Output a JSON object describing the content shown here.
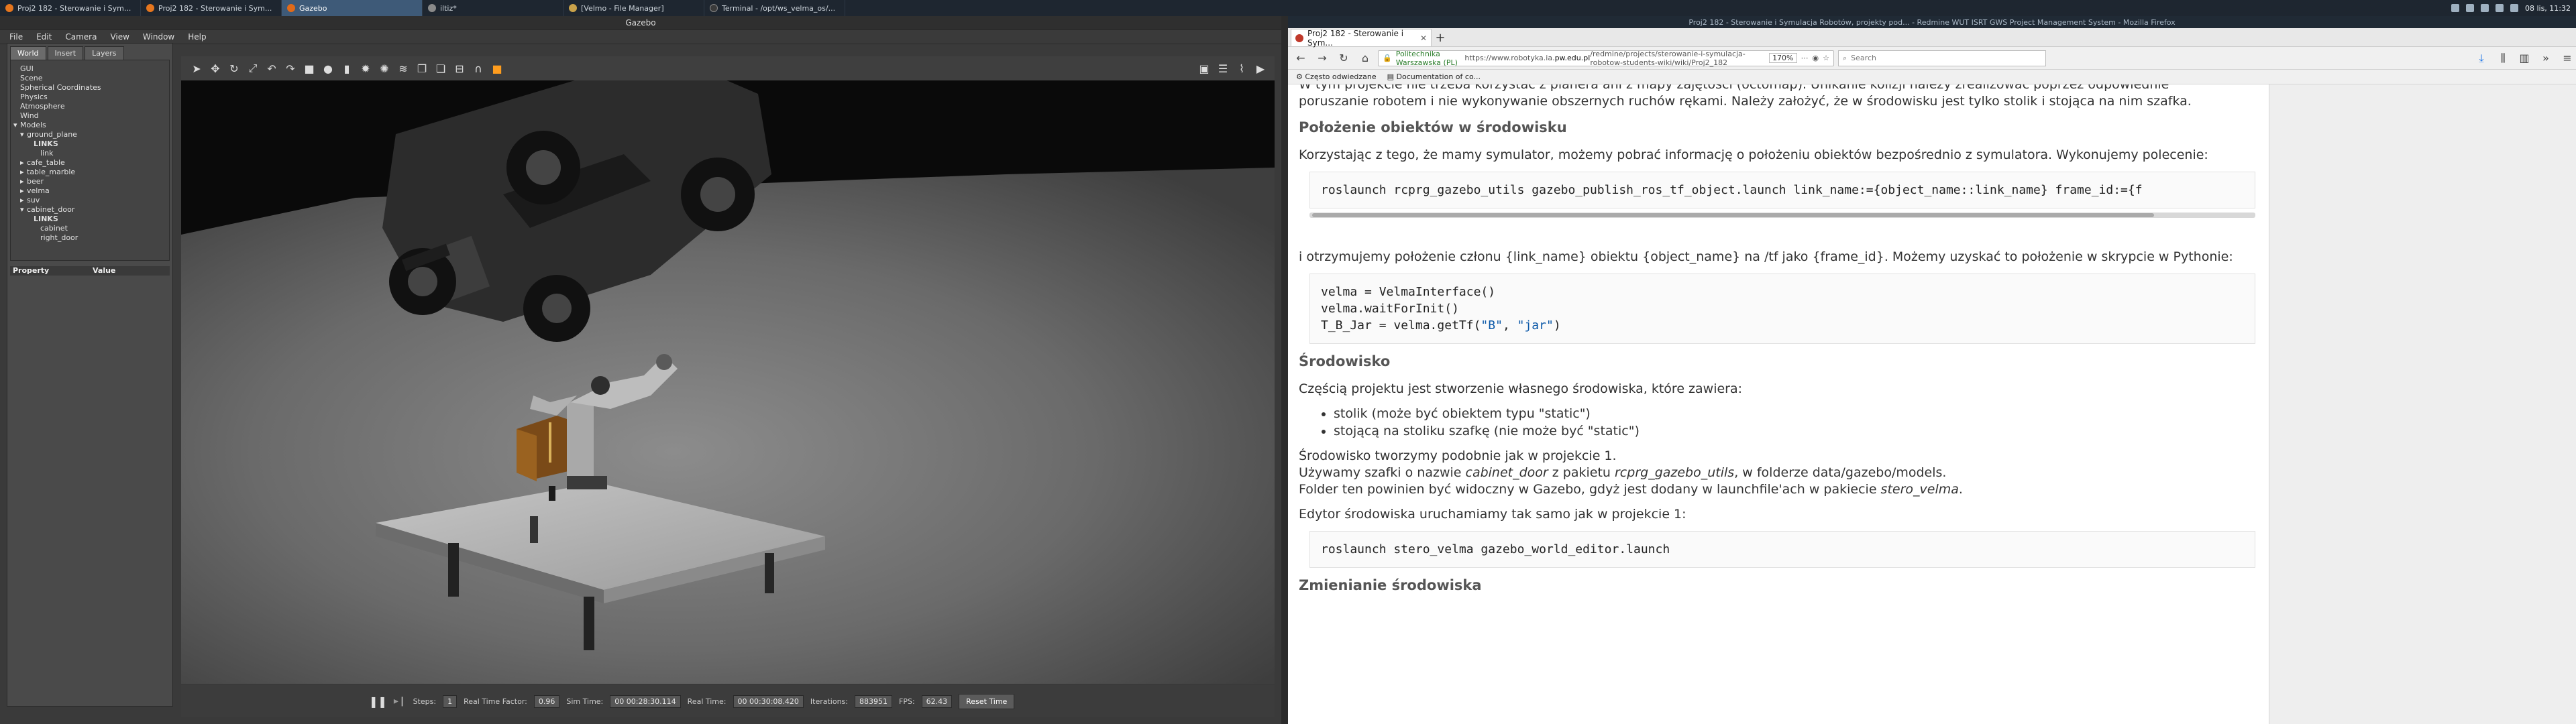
{
  "taskbar": {
    "tasks": [
      {
        "label": "Proj2 182 - Sterowanie i Sym...",
        "color": "#e6761e"
      },
      {
        "label": "Proj2 182 - Sterowanie i Sym...",
        "color": "#e6761e"
      },
      {
        "label": "Gazebo",
        "color": "#e06a19",
        "active": true
      },
      {
        "label": "iltiz*",
        "color": "#8a8a8a"
      },
      {
        "label": "[Velmo - File Manager]",
        "color": "#c9a24a"
      },
      {
        "label": "Terminal - /opt/ws_velma_os/...",
        "color": "#3a3a3a"
      }
    ],
    "clock": "08 lis, 11:32"
  },
  "gazebo": {
    "title": "Gazebo",
    "menu": [
      "File",
      "Edit",
      "Camera",
      "View",
      "Window",
      "Help"
    ],
    "tabs": [
      "World",
      "Insert",
      "Layers"
    ],
    "tree": [
      {
        "label": "GUI",
        "indent": 0,
        "arrow": ""
      },
      {
        "label": "Scene",
        "indent": 0,
        "arrow": ""
      },
      {
        "label": "Spherical Coordinates",
        "indent": 0,
        "arrow": ""
      },
      {
        "label": "Physics",
        "indent": 0,
        "arrow": ""
      },
      {
        "label": "Atmosphere",
        "indent": 0,
        "arrow": ""
      },
      {
        "label": "Wind",
        "indent": 0,
        "arrow": ""
      },
      {
        "label": "Models",
        "indent": 0,
        "arrow": "▾"
      },
      {
        "label": "ground_plane",
        "indent": 1,
        "arrow": "▾"
      },
      {
        "label": "LINKS",
        "indent": 2,
        "arrow": "",
        "bold": true
      },
      {
        "label": "link",
        "indent": 3,
        "arrow": ""
      },
      {
        "label": "cafe_table",
        "indent": 1,
        "arrow": "▸"
      },
      {
        "label": "table_marble",
        "indent": 1,
        "arrow": "▸"
      },
      {
        "label": "beer",
        "indent": 1,
        "arrow": "▸"
      },
      {
        "label": "velma",
        "indent": 1,
        "arrow": "▸"
      },
      {
        "label": "suv",
        "indent": 1,
        "arrow": "▸"
      },
      {
        "label": "cabinet_door",
        "indent": 1,
        "arrow": "▾"
      },
      {
        "label": "LINKS",
        "indent": 2,
        "arrow": "",
        "bold": true
      },
      {
        "label": "cabinet",
        "indent": 3,
        "arrow": ""
      },
      {
        "label": "right_door",
        "indent": 3,
        "arrow": ""
      }
    ],
    "props_header": {
      "property": "Property",
      "value": "Value"
    },
    "bottom": {
      "steps_label": "Steps:",
      "steps_value": "1",
      "rtf_label": "Real Time Factor:",
      "rtf_value": "0.96",
      "sim_label": "Sim Time:",
      "sim_value": "00 00:28:30.114",
      "real_label": "Real Time:",
      "real_value": "00 00:30:08.420",
      "iter_label": "Iterations:",
      "iter_value": "883951",
      "fps_label": "FPS:",
      "fps_value": "62.43",
      "reset_label": "Reset Time"
    }
  },
  "firefox": {
    "window_title": "Proj2 182 - Sterowanie i Symulacja Robotów, projekty pod... - Redmine WUT ISRT GWS Project Management System - Mozilla Firefox",
    "tab_label": "Proj2 182 - Sterowanie i Sym...",
    "url_org": "Politechnika Warszawska (PL)",
    "url_prefix": "https://www.robotyka.ia.",
    "url_domain": "pw.edu.pl",
    "url_suffix": "/redmine/projects/sterowanie-i-symulacja-robotow-students-wiki/wiki/Proj2_182",
    "zoom": "170%",
    "search_placeholder": "Search",
    "bookmarks": [
      "Często odwiedzane",
      "Documentation of co..."
    ],
    "content": {
      "intro_top": "W tym projekcie nie trzeba korzystać z planera ani z mapy zajętości (octomap). Unikanie kolizji należy zrealizować poprzez odpowiednie",
      "intro_bottom": "poruszanie robotem i nie wykonywanie obszernych ruchów rękami. Należy założyć, że w środowisku jest tylko stolik i stojąca na nim szafka.",
      "h_positions": "Położenie obiektów w środowisku",
      "p_sim": "Korzystając z tego, że mamy symulator, możemy pobrać informację o położeniu obiektów bezpośrednio z symulatora. Wykonujemy polecenie:",
      "code_roslaunch_tf": "roslaunch rcprg_gazebo_utils gazebo_publish_ros_tf_object.launch link_name:={object_name::link_name} frame_id:={f",
      "p_frame": "i otrzymujemy położenie członu {link_name} obiektu {object_name} na /tf jako {frame_id}. Możemy uzyskać to położenie w skrypcie w Pythonie:",
      "code_py_1": "velma = VelmaInterface()",
      "code_py_2": "velma.waitForInit()",
      "code_py_3a": "T_B_Jar = velma.getTf(",
      "code_py_3s1": "\"B\"",
      "code_py_3c": ", ",
      "code_py_3s2": "\"jar\"",
      "code_py_3e": ")",
      "h_env": "Środowisko",
      "p_env": "Częścią projektu jest stworzenie własnego środowiska, które zawiera:",
      "list": [
        "stolik (może być obiektem typu \"static\")",
        "stojącą na stoliku szafkę (nie może być \"static\")"
      ],
      "p_create": "Środowisko tworzymy podobnie jak w projekcie 1.",
      "p_cab_a": "Używamy szafki o nazwie ",
      "p_cab_em1": "cabinet_door",
      "p_cab_b": " z pakietu ",
      "p_cab_em2": "rcprg_gazebo_utils",
      "p_cab_c": ", w folderze data/gazebo/models.",
      "p_folder_a": "Folder ten powinien być widoczny w Gazebo, gdyż jest dodany w launchfile'ach w pakiecie ",
      "p_folder_em": "stero_velma",
      "p_folder_b": ".",
      "p_editor": "Edytor środowiska uruchamiamy tak samo jak w projekcie 1:",
      "code_editor": "roslaunch stero_velma gazebo_world_editor.launch",
      "h_change": "Zmienianie środowiska"
    }
  }
}
